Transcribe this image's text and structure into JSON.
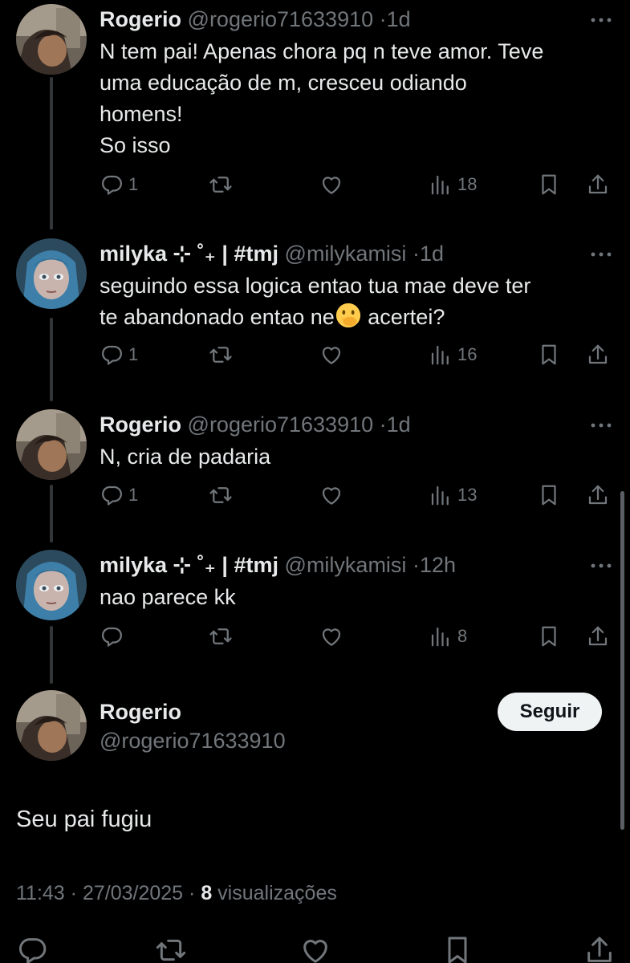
{
  "thread": [
    {
      "name": "Rogerio",
      "handle": "@rogerio71633910",
      "separator": "·",
      "time": "1d",
      "text": "N tem pai! Apenas chora pq n teve amor. Teve\numa educação de m, cresceu odiando\nhomens!\nSo isso",
      "text_after_emoji": "",
      "replies": "1",
      "retweets": "",
      "likes": "",
      "views": "18"
    },
    {
      "name": "milyka ⊹ ˚₊ | #tmj",
      "handle": "@milykamisi",
      "separator": "·",
      "time": "1d",
      "text": "seguindo essa logica entao tua mae deve ter\nte abandonado entao ne",
      "text_after_emoji": " acertei?",
      "replies": "1",
      "retweets": "",
      "likes": "",
      "views": "16"
    },
    {
      "name": "Rogerio",
      "handle": "@rogerio71633910",
      "separator": "·",
      "time": "1d",
      "text": "N, cria de padaria",
      "text_after_emoji": "",
      "replies": "1",
      "retweets": "",
      "likes": "",
      "views": "13"
    },
    {
      "name": "milyka ⊹ ˚₊ | #tmj",
      "handle": "@milykamisi",
      "separator": "·",
      "time": "12h",
      "text": "nao parece kk",
      "text_after_emoji": "",
      "replies": "",
      "retweets": "",
      "likes": "",
      "views": "8"
    }
  ],
  "main_tweet": {
    "name": "Rogerio",
    "handle": "@rogerio71633910",
    "follow_label": "Seguir",
    "text": "Seu pai fugiu",
    "time": "11:43",
    "date": "27/03/2025",
    "separator": "·",
    "views_count": "8",
    "views_label": "visualizações"
  },
  "icons": {
    "reply": "reply-icon",
    "retweet": "retweet-icon",
    "like": "heart-icon",
    "views": "views-icon",
    "bookmark": "bookmark-icon",
    "share": "share-icon",
    "more": "more-icon",
    "emoji": "face-with-hand-over-mouth-emoji"
  },
  "colors": {
    "background": "#000000",
    "text": "#e7e9ea",
    "secondary": "#71767b",
    "follow_bg": "#eff3f4"
  }
}
